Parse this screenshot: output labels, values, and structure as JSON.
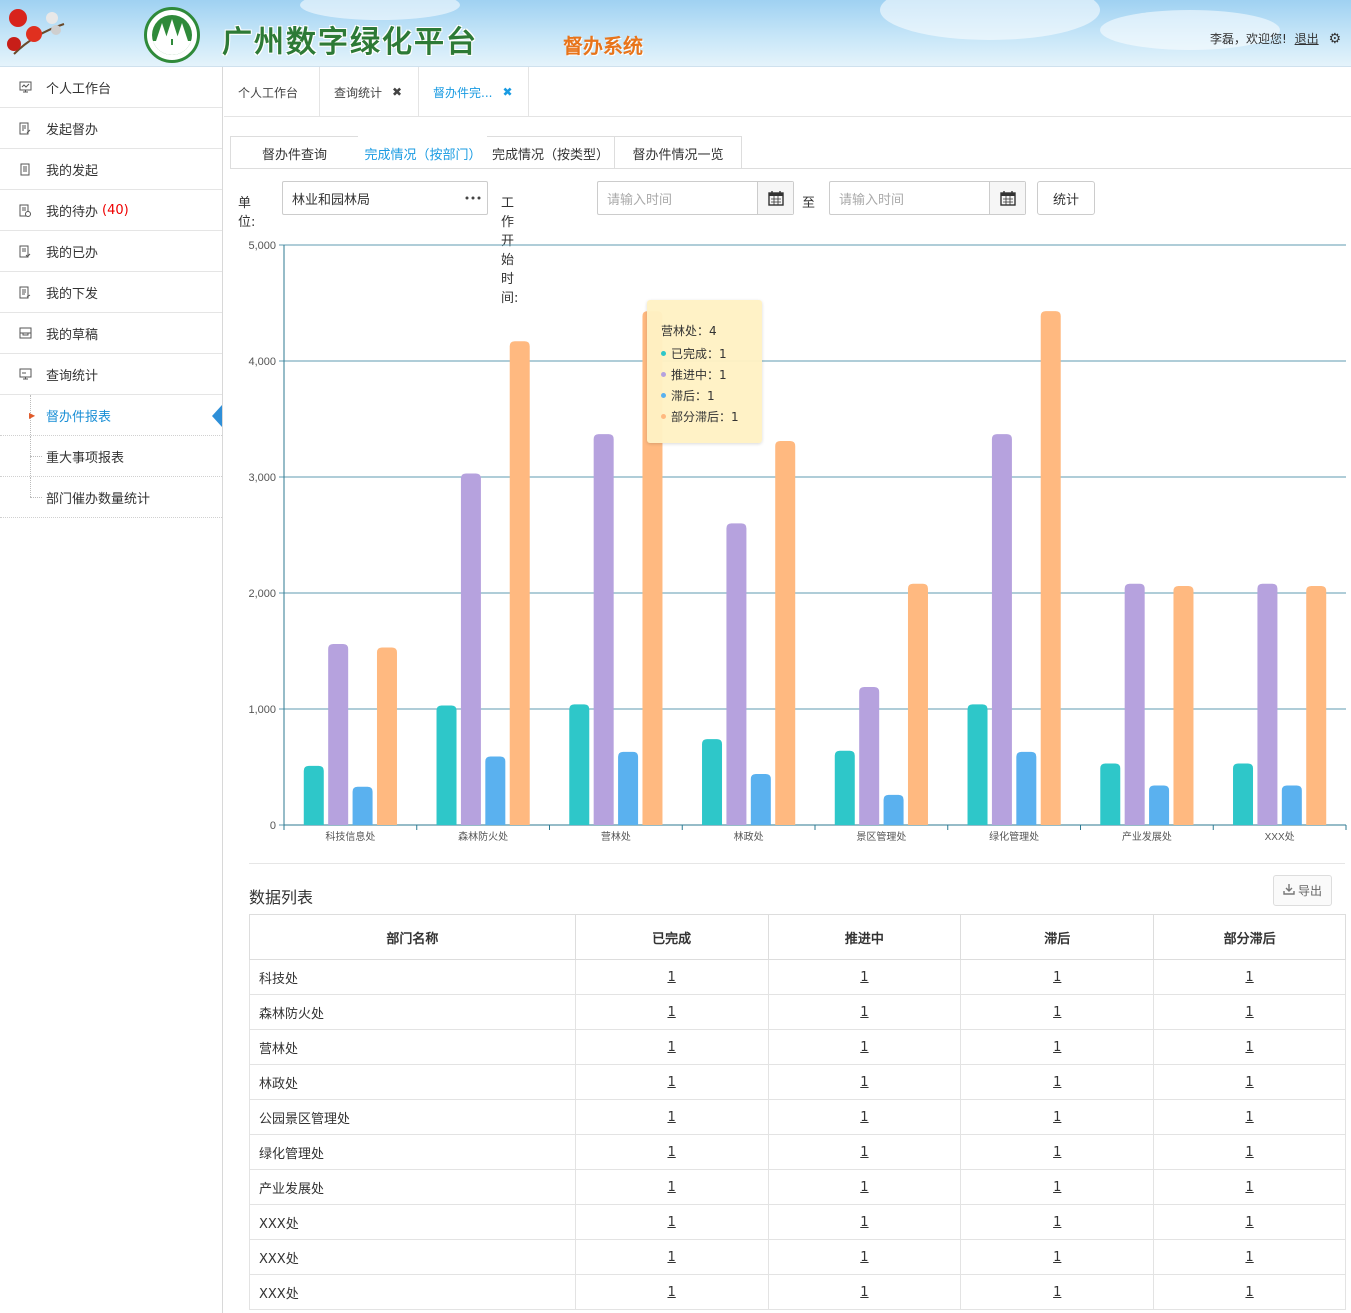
{
  "header": {
    "title": "广州数字绿化平台",
    "subtitle": "督办系统",
    "user_greeting": "李磊，欢迎您!",
    "logout_label": "退出"
  },
  "sidebar": {
    "items": [
      {
        "label": "个人工作台",
        "icon": "monitor-icon"
      },
      {
        "label": "发起督办",
        "icon": "edit-doc-icon"
      },
      {
        "label": "我的发起",
        "icon": "list-doc-icon"
      },
      {
        "label": "我的待办",
        "badge": "(40)",
        "icon": "pending-doc-icon"
      },
      {
        "label": "我的已办",
        "icon": "done-doc-icon"
      },
      {
        "label": "我的下发",
        "icon": "dispatch-doc-icon"
      },
      {
        "label": "我的草稿",
        "icon": "draft-icon"
      },
      {
        "label": "查询统计",
        "icon": "stats-monitor-icon"
      }
    ],
    "subitems": [
      {
        "label": "督办件报表",
        "active": true
      },
      {
        "label": "重大事项报表"
      },
      {
        "label": "部门催办数量统计"
      }
    ]
  },
  "tabs": [
    {
      "label": "个人工作台"
    },
    {
      "label": "查询统计"
    },
    {
      "label": "督办件完..."
    }
  ],
  "subtabs": [
    {
      "label": "督办件查询"
    },
    {
      "label": "完成情况（按部门）"
    },
    {
      "label": "完成情况（按类型）"
    },
    {
      "label": "督办件情况一览"
    }
  ],
  "filter": {
    "unit_label": "单位:",
    "unit_value": "林业和园林局",
    "start_label": "工作开始时间:",
    "date_placeholder": "请输入时间",
    "to_label": "至",
    "stat_button": "统计"
  },
  "chart_data": {
    "type": "bar",
    "categories": [
      "科技信息处",
      "森林防火处",
      "营林处",
      "林政处",
      "景区管理处",
      "绿化管理处",
      "产业发展处",
      "XXX处"
    ],
    "series": [
      {
        "name": "已完成",
        "color": "#2ec7c9",
        "values": [
          510,
          1030,
          1040,
          740,
          640,
          1040,
          530,
          530
        ]
      },
      {
        "name": "推进中",
        "color": "#b6a2de",
        "values": [
          1560,
          3030,
          3370,
          2600,
          1190,
          3370,
          2080,
          2080
        ]
      },
      {
        "name": "滞后",
        "color": "#5ab1ef",
        "values": [
          330,
          590,
          630,
          440,
          260,
          630,
          340,
          340
        ]
      },
      {
        "name": "部分滞后",
        "color": "#ffb980",
        "values": [
          1530,
          4170,
          4430,
          3310,
          2080,
          4430,
          2060,
          2060
        ]
      }
    ],
    "yticks": [
      "0",
      "1,000",
      "2,000",
      "3,000",
      "4,000",
      "5,000"
    ],
    "ylim": [
      0,
      5000
    ],
    "grid": true
  },
  "tooltip": {
    "title": "营林处：4",
    "rows": [
      {
        "text": "已完成：1",
        "color": "#2ec7c9"
      },
      {
        "text": "推进中：1",
        "color": "#b6a2de"
      },
      {
        "text": "滞后：1",
        "color": "#5ab1ef"
      },
      {
        "text": "部分滞后：1",
        "color": "#ffb980"
      }
    ]
  },
  "list": {
    "title": "数据列表",
    "export_label": "导出",
    "columns": [
      "部门名称",
      "已完成",
      "推进中",
      "滞后",
      "部分滞后"
    ],
    "rows": [
      [
        "科技处",
        "1",
        "1",
        "1",
        "1"
      ],
      [
        "森林防火处",
        "1",
        "1",
        "1",
        "1"
      ],
      [
        "营林处",
        "1",
        "1",
        "1",
        "1"
      ],
      [
        "林政处",
        "1",
        "1",
        "1",
        "1"
      ],
      [
        "公园景区管理处",
        "1",
        "1",
        "1",
        "1"
      ],
      [
        "绿化管理处",
        "1",
        "1",
        "1",
        "1"
      ],
      [
        "产业发展处",
        "1",
        "1",
        "1",
        "1"
      ],
      [
        "XXX处",
        "1",
        "1",
        "1",
        "1"
      ],
      [
        "XXX处",
        "1",
        "1",
        "1",
        "1"
      ],
      [
        "XXX处",
        "1",
        "1",
        "1",
        "1"
      ]
    ]
  }
}
